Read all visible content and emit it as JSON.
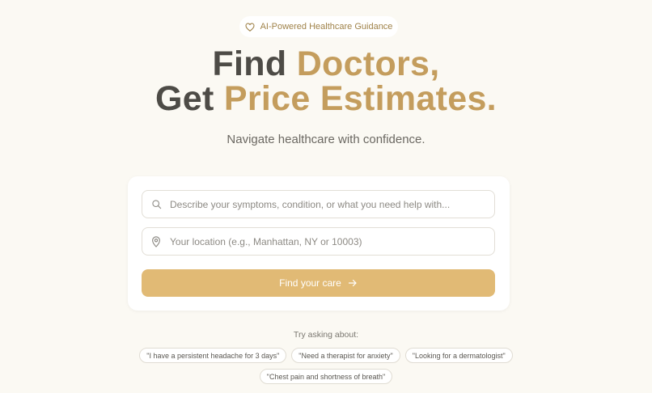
{
  "badge": {
    "icon": "heart-icon",
    "label": "AI-Powered Healthcare Guidance"
  },
  "headline": {
    "line1_dark": "Find",
    "line1_gold": "Doctors,",
    "line2_dark": "Get",
    "line2_gold": "Price Estimates."
  },
  "subtitle": "Navigate healthcare with confidence.",
  "search": {
    "symptoms_icon": "search-icon",
    "symptoms_value": "",
    "symptoms_placeholder": "Describe your symptoms, condition, or what you need help with...",
    "location_icon": "map-pin-icon",
    "location_value": "",
    "location_placeholder": "Your location (e.g., Manhattan, NY or 10003)",
    "submit_label": "Find your care",
    "submit_icon": "arrow-right-icon"
  },
  "suggestions": {
    "label": "Try asking about:",
    "items": [
      "\"I have a persistent headache for 3 days\"",
      "\"Need a therapist for anxiety\"",
      "\"Looking for a dermatologist\"",
      "\"Chest pain and shortness of breath\""
    ]
  },
  "colors": {
    "background": "#fbf9f3",
    "accent_gold": "#c49d5d",
    "button_gold": "#e1ba75",
    "heading_dark": "#4d4b46"
  }
}
